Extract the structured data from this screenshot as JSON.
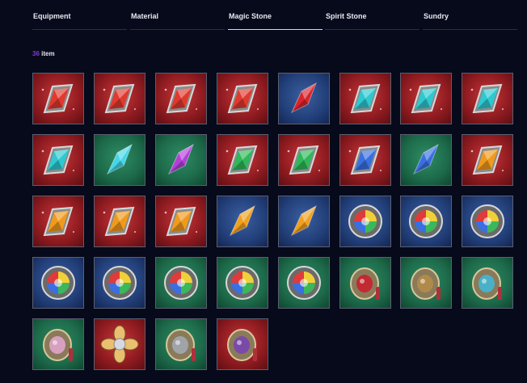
{
  "tabs": [
    {
      "label": "Equipment"
    },
    {
      "label": "Material"
    },
    {
      "label": "Magic Stone"
    },
    {
      "label": "Spirit Stone"
    },
    {
      "label": "Sundry"
    }
  ],
  "active_tab": "Magic Stone",
  "inventory": {
    "count": "36",
    "count_suffix": "item",
    "items": [
      {
        "bg": "red",
        "icon": "diamond-gem-icon",
        "gem": "#e0392e"
      },
      {
        "bg": "red",
        "icon": "diamond-gem-icon",
        "gem": "#e0392e"
      },
      {
        "bg": "red",
        "icon": "diamond-gem-icon",
        "gem": "#e0392e"
      },
      {
        "bg": "red",
        "icon": "diamond-gem-icon",
        "gem": "#e0392e"
      },
      {
        "bg": "blue",
        "icon": "crystal-shard-icon",
        "gem": "#d8242c"
      },
      {
        "bg": "red",
        "icon": "diamond-gem-icon",
        "gem": "#2ec9d0"
      },
      {
        "bg": "red",
        "icon": "diamond-gem-icon",
        "gem": "#2ec9d0"
      },
      {
        "bg": "red",
        "icon": "diamond-gem-icon",
        "gem": "#2ec9d0"
      },
      {
        "bg": "red",
        "icon": "diamond-gem-icon",
        "gem": "#2ec9d0"
      },
      {
        "bg": "green",
        "icon": "crystal-shard-icon",
        "gem": "#44d6e8"
      },
      {
        "bg": "green",
        "icon": "crystal-shard-icon",
        "gem": "#b240d8"
      },
      {
        "bg": "red",
        "icon": "diamond-gem-icon",
        "gem": "#2fb85a"
      },
      {
        "bg": "red",
        "icon": "diamond-gem-icon",
        "gem": "#2fb85a"
      },
      {
        "bg": "red",
        "icon": "diamond-gem-icon",
        "gem": "#3a6fe0"
      },
      {
        "bg": "green",
        "icon": "crystal-shard-icon",
        "gem": "#3a6fe0"
      },
      {
        "bg": "red",
        "icon": "diamond-gem-icon",
        "gem": "#f09a1c"
      },
      {
        "bg": "red",
        "icon": "diamond-gem-icon",
        "gem": "#f09a1c"
      },
      {
        "bg": "red",
        "icon": "diamond-gem-icon",
        "gem": "#f09a1c"
      },
      {
        "bg": "red",
        "icon": "diamond-gem-icon",
        "gem": "#f09a1c"
      },
      {
        "bg": "blue",
        "icon": "crystal-shard-icon",
        "gem": "#f0a020"
      },
      {
        "bg": "blue",
        "icon": "crystal-shard-icon",
        "gem": "#f0a020"
      },
      {
        "bg": "blue",
        "icon": "rainbow-orb-icon",
        "gem": "#c0c0c0"
      },
      {
        "bg": "blue",
        "icon": "rainbow-orb-icon",
        "gem": "#c0c0c0"
      },
      {
        "bg": "blue",
        "icon": "rainbow-orb-icon",
        "gem": "#c0c0c0"
      },
      {
        "bg": "blue",
        "icon": "rainbow-orb-icon",
        "gem": "#c0c0c0"
      },
      {
        "bg": "blue",
        "icon": "rainbow-orb-icon",
        "gem": "#c0c0c0"
      },
      {
        "bg": "green",
        "icon": "rainbow-orb-icon",
        "gem": "#c0c0c0"
      },
      {
        "bg": "green",
        "icon": "rainbow-orb-icon",
        "gem": "#c0c0c0"
      },
      {
        "bg": "green",
        "icon": "rainbow-orb-icon",
        "gem": "#c0c0c0"
      },
      {
        "bg": "green",
        "icon": "ornate-amulet-icon",
        "gem": "#c02a30"
      },
      {
        "bg": "green",
        "icon": "ornate-amulet-icon",
        "gem": "#b08a4a"
      },
      {
        "bg": "green",
        "icon": "ornate-amulet-icon",
        "gem": "#4ab0c8"
      },
      {
        "bg": "green",
        "icon": "ornate-amulet-icon",
        "gem": "#d8a0c0"
      },
      {
        "bg": "red",
        "icon": "flower-brooch-icon",
        "gem": "#e8c070"
      },
      {
        "bg": "green",
        "icon": "ornate-amulet-icon",
        "gem": "#a0a4a8"
      },
      {
        "bg": "red",
        "icon": "ornate-amulet-icon",
        "gem": "#7a4aa8"
      }
    ]
  }
}
